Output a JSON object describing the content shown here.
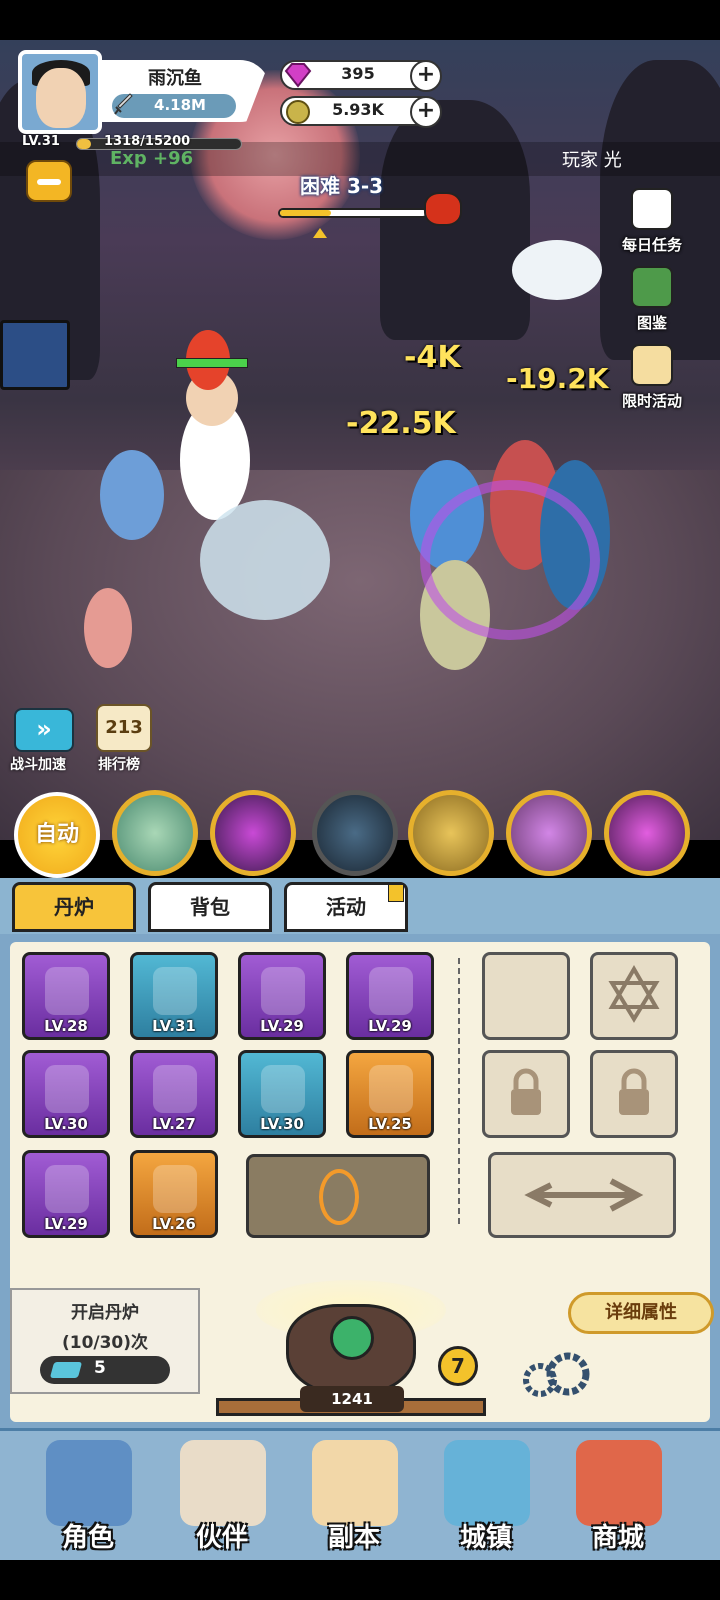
{
  "player": {
    "name": "雨沉鱼",
    "power": "4.18M",
    "level": "LV.31",
    "exp_text": "1318/15200",
    "exp_fraction": 0.087,
    "exp_gain": "Exp +96"
  },
  "currency": {
    "gems": "395",
    "gold": "5.93K"
  },
  "ticker": {
    "text": "玩家 光"
  },
  "stage": {
    "title": "困难 3-3",
    "progress": 0.35
  },
  "side_buttons": {
    "daily": "每日任务",
    "codex": "图鉴",
    "event": "限时活动"
  },
  "damage_numbers": [
    "-4K",
    "-19.2K",
    "-22.5K"
  ],
  "left_buttons": {
    "speed": "战斗加速",
    "rank": "排行榜",
    "rank_digits": "213"
  },
  "skills": {
    "auto": "自动"
  },
  "tabs": [
    "丹炉",
    "背包",
    "活动"
  ],
  "inventory": [
    {
      "level": "LV.28",
      "rarity": "purple"
    },
    {
      "level": "LV.31",
      "rarity": "blue"
    },
    {
      "level": "LV.29",
      "rarity": "purple"
    },
    {
      "level": "LV.29",
      "rarity": "purple"
    },
    {
      "level": "LV.30",
      "rarity": "purple"
    },
    {
      "level": "LV.27",
      "rarity": "purple"
    },
    {
      "level": "LV.30",
      "rarity": "blue"
    },
    {
      "level": "LV.25",
      "rarity": "orange"
    },
    {
      "level": "LV.29",
      "rarity": "purple"
    },
    {
      "level": "LV.26",
      "rarity": "orange"
    }
  ],
  "furnace": {
    "open_title": "开启丹炉",
    "open_count": "(10/30)次",
    "tickets": "5",
    "level": "7",
    "value": "1241",
    "detail_button": "详细属性"
  },
  "nav": [
    "角色",
    "伙伴",
    "副本",
    "城镇",
    "商城"
  ],
  "colors": {
    "accent": "#f3c22b",
    "panel": "#7ea6c7",
    "cream": "#f7f2df"
  }
}
